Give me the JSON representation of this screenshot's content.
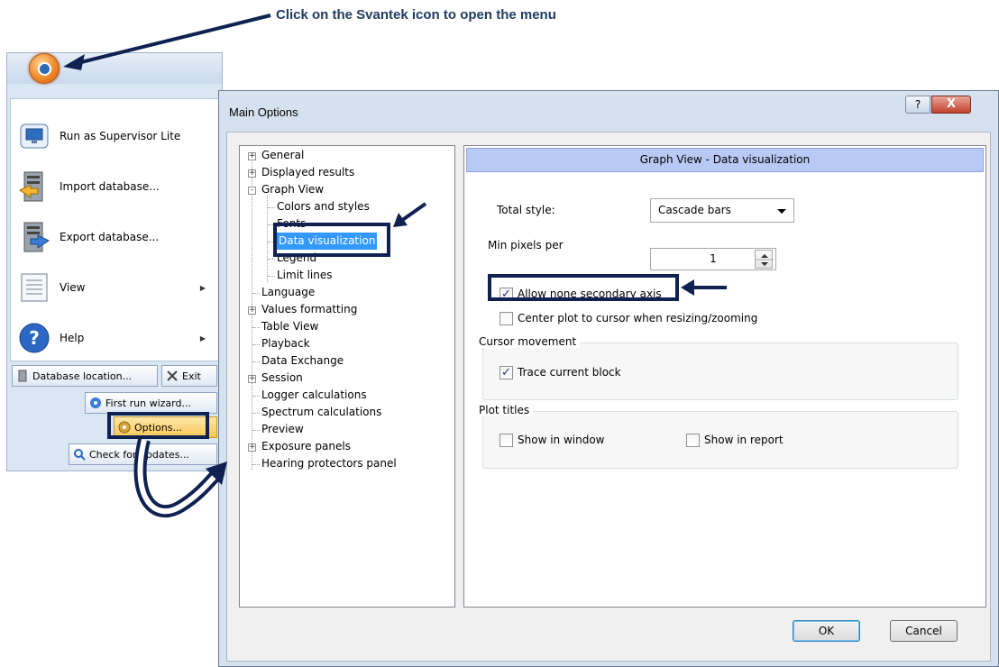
{
  "instruction": "Click on the Svantek icon to open the menu",
  "app_menu": {
    "items": [
      {
        "label": "Run as Supervisor Lite",
        "icon": "monitor-icon"
      },
      {
        "label": "Import database...",
        "icon": "import-database-icon"
      },
      {
        "label": "Export database...",
        "icon": "export-database-icon"
      },
      {
        "label": "View",
        "icon": "view-document-icon",
        "has_submenu": true
      },
      {
        "label": "Help",
        "icon": "help-icon",
        "has_submenu": true
      }
    ],
    "buttons": {
      "database_location": "Database location...",
      "exit": "Exit",
      "first_run_wizard": "First run wizard...",
      "options": "Options...",
      "check_updates": "Check for updates..."
    }
  },
  "dialog": {
    "title": "Main Options",
    "help_glyph": "?",
    "close_glyph": "X",
    "tree": [
      {
        "label": "General",
        "expander": "+",
        "level": 0
      },
      {
        "label": "Displayed results",
        "expander": "+",
        "level": 0
      },
      {
        "label": "Graph View",
        "expander": "-",
        "level": 0
      },
      {
        "label": "Colors and styles",
        "level": 1
      },
      {
        "label": "Fonts",
        "level": 1
      },
      {
        "label": "Data visualization",
        "level": 1,
        "selected": true
      },
      {
        "label": "Legend",
        "level": 1
      },
      {
        "label": "Limit lines",
        "level": 1
      },
      {
        "label": "Language",
        "level": 0
      },
      {
        "label": "Values formatting",
        "expander": "+",
        "level": 0
      },
      {
        "label": "Table View",
        "level": 0
      },
      {
        "label": "Playback",
        "level": 0
      },
      {
        "label": "Data Exchange",
        "level": 0
      },
      {
        "label": "Session",
        "expander": "+",
        "level": 0
      },
      {
        "label": "Logger calculations",
        "level": 0
      },
      {
        "label": "Spectrum calculations",
        "level": 0
      },
      {
        "label": "Preview",
        "level": 0
      },
      {
        "label": "Exposure panels",
        "expander": "+",
        "level": 0
      },
      {
        "label": "Hearing protectors panel",
        "level": 0
      }
    ],
    "panel": {
      "header": "Graph View - Data visualization",
      "total_style_label": "Total style:",
      "total_style_value": "Cascade bars",
      "min_pixels_label": "Min pixels per",
      "min_pixels_value": "1",
      "allow_secondary_axis": {
        "label": "Allow none secondary axis",
        "checked": true
      },
      "center_plot": {
        "label": "Center plot to cursor when resizing/zooming",
        "checked": false
      },
      "cursor_group": {
        "title": "Cursor movement",
        "trace_block": {
          "label": "Trace current block",
          "checked": true
        }
      },
      "plot_titles_group": {
        "title": "Plot titles",
        "show_in_window": {
          "label": "Show in window",
          "checked": false
        },
        "show_in_report": {
          "label": "Show in report",
          "checked": false
        }
      }
    },
    "buttons": {
      "ok": "OK",
      "cancel": "Cancel"
    }
  },
  "colors": {
    "annotation": "#0e2151",
    "selection": "#3399ff",
    "panel_header": "#b7c9f4"
  }
}
